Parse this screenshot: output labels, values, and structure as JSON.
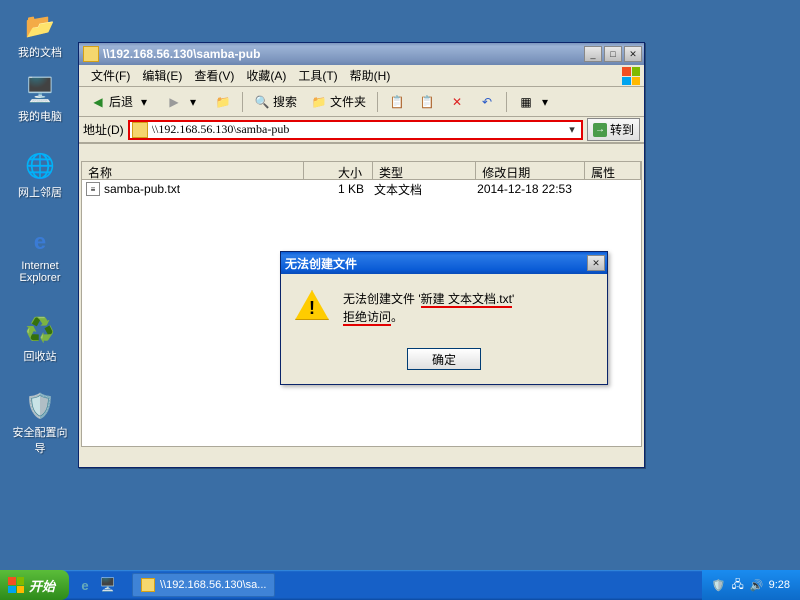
{
  "desktop": {
    "icons": [
      {
        "label": "我的文档",
        "glyph": "📁"
      },
      {
        "label": "我的电脑",
        "glyph": "🖥️"
      },
      {
        "label": "网上邻居",
        "glyph": "🌐"
      },
      {
        "label": "Internet Explorer",
        "glyph": "🌐"
      },
      {
        "label": "回收站",
        "glyph": "🗑️"
      },
      {
        "label": "安全配置向导",
        "glyph": "🛡️"
      }
    ]
  },
  "explorer": {
    "title": "\\\\192.168.56.130\\samba-pub",
    "menu": {
      "file": "文件(F)",
      "edit": "编辑(E)",
      "view": "查看(V)",
      "favorites": "收藏(A)",
      "tools": "工具(T)",
      "help": "帮助(H)"
    },
    "toolbar": {
      "back": "后退",
      "search": "搜索",
      "folders": "文件夹"
    },
    "addressbar": {
      "label": "地址(D)",
      "value": "\\\\192.168.56.130\\samba-pub",
      "go": "转到"
    },
    "columns": {
      "name": "名称",
      "size": "大小",
      "type": "类型",
      "date": "修改日期",
      "attr": "属性"
    },
    "files": [
      {
        "name": "samba-pub.txt",
        "size": "1 KB",
        "type": "文本文档",
        "date": "2014-12-18 22:53",
        "attr": ""
      }
    ]
  },
  "dialog": {
    "title": "无法创建文件",
    "line1_pre": "无法创建文件 '",
    "line1_ul": "新建 文本文档.txt",
    "line1_post": "'",
    "line2": "拒绝访问",
    "line2_post": "。",
    "ok": "确定"
  },
  "taskbar": {
    "start": "开始",
    "task": "\\\\192.168.56.130\\sa...",
    "time": "9:28"
  }
}
